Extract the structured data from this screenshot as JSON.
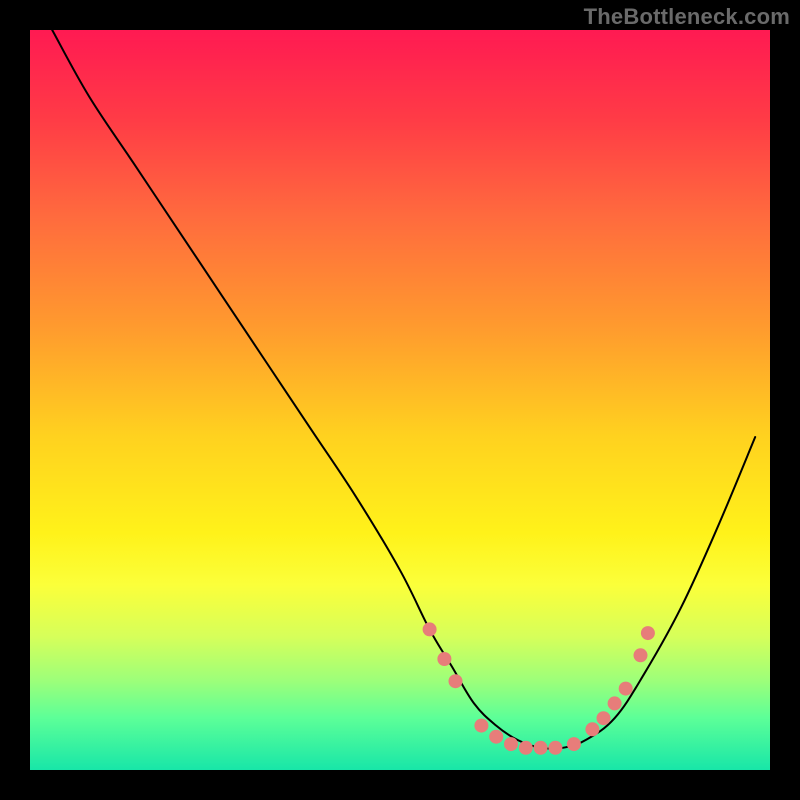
{
  "watermark": "TheBottleneck.com",
  "chart_data": {
    "type": "line",
    "title": "",
    "xlabel": "",
    "ylabel": "",
    "xlim": [
      0,
      100
    ],
    "ylim": [
      0,
      100
    ],
    "grid": false,
    "legend": false,
    "series": [
      {
        "name": "bottleneck-curve",
        "color": "#000000",
        "x": [
          3,
          8,
          14,
          20,
          26,
          32,
          38,
          44,
          50,
          54,
          57,
          60,
          63,
          66,
          69,
          72,
          75,
          79,
          83,
          88,
          93,
          98
        ],
        "y": [
          100,
          91,
          82,
          73,
          64,
          55,
          46,
          37,
          27,
          19,
          14,
          9,
          6,
          4,
          3,
          3,
          4,
          7,
          13,
          22,
          33,
          45
        ]
      }
    ],
    "scatter": {
      "name": "bottleneck-dots",
      "color": "#e77d7a",
      "radius": 7,
      "points": [
        {
          "x": 54,
          "y": 19
        },
        {
          "x": 56,
          "y": 15
        },
        {
          "x": 57.5,
          "y": 12
        },
        {
          "x": 61,
          "y": 6
        },
        {
          "x": 63,
          "y": 4.5
        },
        {
          "x": 65,
          "y": 3.5
        },
        {
          "x": 67,
          "y": 3
        },
        {
          "x": 69,
          "y": 3
        },
        {
          "x": 71,
          "y": 3
        },
        {
          "x": 73.5,
          "y": 3.5
        },
        {
          "x": 76,
          "y": 5.5
        },
        {
          "x": 77.5,
          "y": 7
        },
        {
          "x": 79,
          "y": 9
        },
        {
          "x": 80.5,
          "y": 11
        },
        {
          "x": 82.5,
          "y": 15.5
        },
        {
          "x": 83.5,
          "y": 18.5
        }
      ]
    }
  }
}
